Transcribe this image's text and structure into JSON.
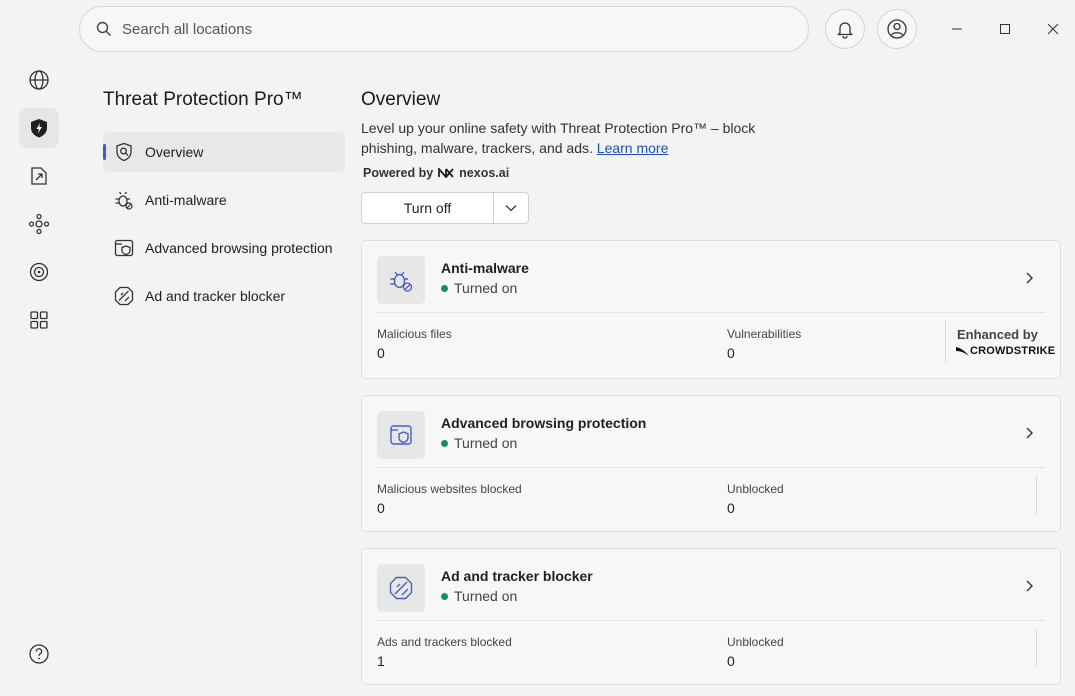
{
  "search": {
    "placeholder": "Search all locations"
  },
  "header": {
    "notifications_icon": "bell-icon",
    "account_icon": "user-circle-icon"
  },
  "window_controls": [
    "minimize",
    "maximize",
    "close"
  ],
  "rail": {
    "items": [
      {
        "icon": "globe-icon"
      },
      {
        "icon": "shield-bolt-icon",
        "active": true
      },
      {
        "icon": "file-share-icon"
      },
      {
        "icon": "meshnet-icon"
      },
      {
        "icon": "target-icon"
      },
      {
        "icon": "apps-grid-icon"
      }
    ],
    "help_icon": "help-icon"
  },
  "sidebar": {
    "title": "Threat Protection Pro™",
    "items": [
      {
        "label": "Overview",
        "icon": "search-shield-icon",
        "active": true
      },
      {
        "label": "Anti-malware",
        "icon": "bug-icon"
      },
      {
        "label": "Advanced browsing protection",
        "icon": "browser-shield-icon"
      },
      {
        "label": "Ad and tracker blocker",
        "icon": "ad-block-icon"
      }
    ]
  },
  "main": {
    "title": "Overview",
    "description": "Level up your online safety with Threat Protection Pro™ – block phishing, malware, trackers, and ads.",
    "learn_more": "Learn more",
    "powered_by_prefix": "Powered by",
    "powered_by_brand": "nexos.ai",
    "turn_off_label": "Turn off"
  },
  "cards": [
    {
      "title": "Anti-malware",
      "status": "Turned on",
      "stats": [
        {
          "label": "Malicious files",
          "value": "0"
        },
        {
          "label": "Vulnerabilities",
          "value": "0"
        }
      ],
      "enhanced_by": "Enhanced by",
      "partner": "CROWDSTRIKE"
    },
    {
      "title": "Advanced browsing protection",
      "status": "Turned on",
      "stats": [
        {
          "label": "Malicious websites blocked",
          "value": "0"
        },
        {
          "label": "Unblocked",
          "value": "0"
        }
      ]
    },
    {
      "title": "Ad and tracker blocker",
      "status": "Turned on",
      "stats": [
        {
          "label": "Ads and trackers blocked",
          "value": "1"
        },
        {
          "label": "Unblocked",
          "value": "0"
        }
      ]
    }
  ],
  "colors": {
    "status_on": "#1a8f5e",
    "accent": "#3c5bd6",
    "link": "#1d4fb8",
    "icon_blue": "#4a5fb8"
  }
}
